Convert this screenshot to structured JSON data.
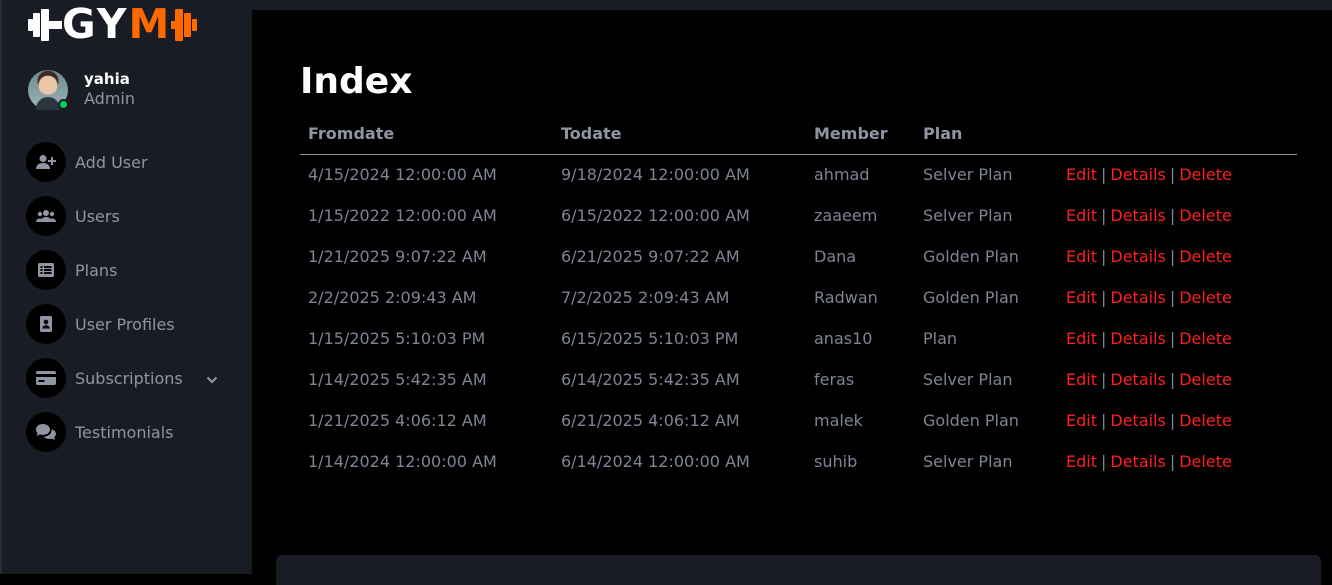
{
  "brand": {
    "logo_text_a": "GY",
    "logo_text_b": "M",
    "accent_color": "#ff6a00",
    "icon": "dumbbell-icon"
  },
  "profile": {
    "name": "yahia",
    "role": "Admin",
    "status_color": "#00d25b"
  },
  "nav": [
    {
      "label": "Add User",
      "icon": "add-user-icon"
    },
    {
      "label": "Users",
      "icon": "users-icon"
    },
    {
      "label": "Plans",
      "icon": "plans-icon"
    },
    {
      "label": "User Profiles",
      "icon": "user-profile-icon"
    },
    {
      "label": "Subscriptions",
      "icon": "credit-card-icon",
      "has_submenu": true
    },
    {
      "label": "Testimonials",
      "icon": "chat-bubbles-icon"
    }
  ],
  "page": {
    "title": "Index"
  },
  "table": {
    "headers": [
      "Fromdate",
      "Todate",
      "Member",
      "Plan",
      ""
    ],
    "rows": [
      {
        "from": "4/15/2024 12:00:00 AM",
        "to": "9/18/2024 12:00:00 AM",
        "member": "ahmad",
        "plan": "Selver Plan"
      },
      {
        "from": "1/15/2022 12:00:00 AM",
        "to": "6/15/2022 12:00:00 AM",
        "member": "zaaeem",
        "plan": "Selver Plan"
      },
      {
        "from": "1/21/2025 9:07:22 AM",
        "to": "6/21/2025 9:07:22 AM",
        "member": "Dana",
        "plan": "Golden Plan"
      },
      {
        "from": "2/2/2025 2:09:43 AM",
        "to": "7/2/2025 2:09:43 AM",
        "member": "Radwan",
        "plan": "Golden Plan"
      },
      {
        "from": "1/15/2025 5:10:03 PM",
        "to": "6/15/2025 5:10:03 PM",
        "member": "anas10",
        "plan": "Plan"
      },
      {
        "from": "1/14/2025 5:42:35 AM",
        "to": "6/14/2025 5:42:35 AM",
        "member": "feras",
        "plan": "Selver Plan"
      },
      {
        "from": "1/21/2025 4:06:12 AM",
        "to": "6/21/2025 4:06:12 AM",
        "member": "malek",
        "plan": "Golden Plan"
      },
      {
        "from": "1/14/2024 12:00:00 AM",
        "to": "6/14/2024 12:00:00 AM",
        "member": "suhib",
        "plan": "Selver Plan"
      }
    ],
    "actions": {
      "edit": "Edit",
      "details": "Details",
      "delete": "Delete",
      "separator": "|",
      "color": "#ff1f1f"
    }
  }
}
